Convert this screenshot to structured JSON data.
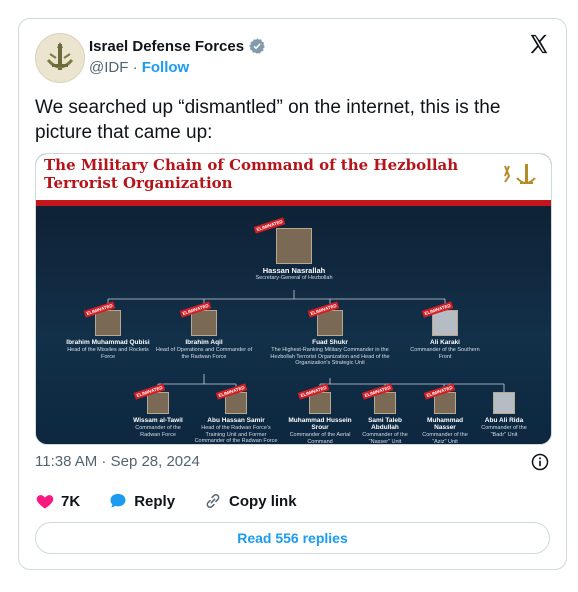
{
  "author": {
    "name": "Israel Defense Forces",
    "handle": "@IDF",
    "separator": "·",
    "follow_label": "Follow"
  },
  "tweet": {
    "text": "We searched up “dismantled” on the internet, this is the picture that came up:",
    "timestamp": "11:38 AM · Sep 28, 2024"
  },
  "media": {
    "title_line1": "The Military Chain of Command of the Hezbollah",
    "title_line2": "Terrorist Organization",
    "eliminated_label": "ELIMINATED",
    "top": {
      "name": "Hassan Nasrallah",
      "role": "Secretary-General of Hezbollah",
      "eliminated": true
    },
    "tier2": [
      {
        "name": "Ibrahim Muhammad Qubisi",
        "role": "Head of the Missiles and Rockets Force",
        "eliminated": true
      },
      {
        "name": "Ibrahim Aqil",
        "role": "Head of Operations and Commander of the Radwan Force",
        "eliminated": true
      },
      {
        "name": "Fuad Shukr",
        "role": "The Highest-Ranking Military Commander in the Hezbollah Terrorist Organization and Head of the Organization's Strategic Unit",
        "eliminated": true
      },
      {
        "name": "Ali Karaki",
        "role": "Commander of the Southern Front",
        "eliminated": true
      }
    ],
    "tier3": [
      {
        "name": "Wissam al-Tawil",
        "role": "Commander of the Radwan Force",
        "eliminated": true
      },
      {
        "name": "Abu Hassan Samir",
        "role": "Head of the Radwan Force's Training Unit and Former Commander of the Radwan Force",
        "eliminated": true
      },
      {
        "name": "Muhammad Hussein Srour",
        "role": "Commander of the Aerial Command",
        "eliminated": true
      },
      {
        "name": "Sami Taleb Abdullah",
        "role": "Commander of the \"Nasser\" Unit",
        "eliminated": true
      },
      {
        "name": "Muhammad Nasser",
        "role": "Commander of the \"Aziz\" Unit",
        "eliminated": true
      },
      {
        "name": "Abu Ali Rida",
        "role": "Commander of the \"Badr\" Unit",
        "eliminated": false
      }
    ]
  },
  "actions": {
    "likes": "7K",
    "reply_label": "Reply",
    "copy_label": "Copy link"
  },
  "read_replies_label": "Read 556 replies",
  "colors": {
    "accent": "#1d9bf0",
    "heart": "#f91880",
    "title_red": "#b6141b",
    "band_red": "#c3161c",
    "chart_bg": "#123049"
  }
}
